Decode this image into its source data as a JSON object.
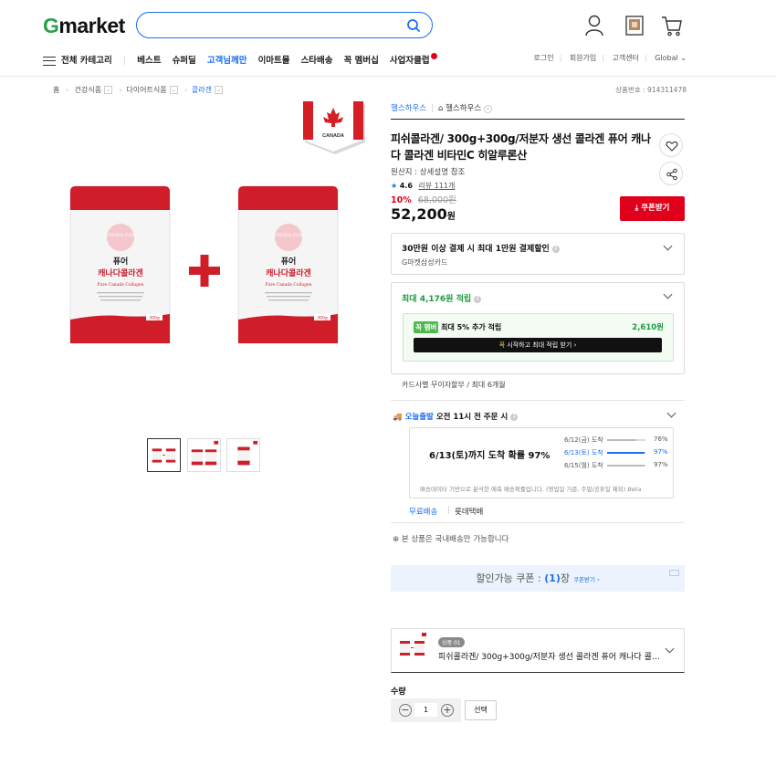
{
  "header": {
    "logo_g": "G",
    "logo_rest": "market",
    "search_placeholder": ""
  },
  "nav": {
    "all_categories": "전체 카테고리",
    "items": [
      "베스트",
      "슈퍼딜",
      "고객님께만",
      "이마트몰",
      "스타배송",
      "꼭 멤버십",
      "사업자클럽"
    ],
    "highlight_color": "#1d6ef5"
  },
  "util": [
    "로그인",
    "회원가입",
    "고객센터",
    "Global"
  ],
  "breadcrumb": [
    "홈",
    "건강식품",
    "다이어트식품",
    "콜라겐"
  ],
  "product_no": "상품번호 : 914311478",
  "store": {
    "name1": "헬스하우스",
    "name2": "헬스하우스"
  },
  "product": {
    "title": "피쉬콜라겐/ 300g+300g/저분자 생선 콜라겐 퓨어 캐나다 콜라겐 비타민C 히알루론산",
    "origin": "원산지 : 상세설명 참조",
    "rating": "4.6",
    "review_count": "리뷰 111개",
    "discount": "10%",
    "original_price": "68,000원",
    "price": "52,200",
    "price_unit": "원",
    "coupon_btn": "쿠폰받기"
  },
  "benefit": {
    "title": "30만원 이상 결제 시 최대 1만원 결제할인",
    "sub": "G마켓삼성카드"
  },
  "points": {
    "prefix": "최대 ",
    "amount": "4,176원",
    "suffix": " 적립",
    "member_tag": "꼭 멤버",
    "member_text": "최대 5% 추가 적립",
    "member_points": "2,610원",
    "member_btn_prefix": "꼭 ",
    "member_btn": "시작하고 최대 적립 받기"
  },
  "card_install": "카드사별 무이자할부 / 최대 6개월",
  "shipping": {
    "tag": "오늘출발",
    "text": "오전 11시 전 주문 시",
    "estimate": "6/13(토)까지 도착 확률 97%",
    "rows": [
      {
        "date": "6/12(금) 도착",
        "pct": "76%",
        "value": 76,
        "active": false
      },
      {
        "date": "6/13(토) 도착",
        "pct": "97%",
        "value": 97,
        "active": true
      },
      {
        "date": "6/15(월) 도착",
        "pct": "97%",
        "value": 97,
        "active": false
      }
    ],
    "footnote": "배송데이터 기반으로 분석한 예측 배송확률입니다. (영업일 기준, 주말/공휴일 제외)",
    "beta": "Beta",
    "free": "무료배송",
    "carrier": "롯데택배",
    "domestic": "본 상품은 국내배송만 가능합니다"
  },
  "coupon_bar": {
    "pre": "할인가능 쿠폰 : ",
    "count": "(1)",
    "post": "장",
    "link": "쿠폰받기"
  },
  "option": {
    "tag": "상품 01",
    "name": "피쉬콜라겐/ 300g+300g/저분자 생선 콜라겐 퓨어 캐나다 콜라겐 비타민C 히알루론산"
  },
  "quantity": {
    "label": "수량",
    "value": "1",
    "select_btn": "선택"
  },
  "packaging": {
    "flag_label": "CANADA",
    "brand": "CANADA FISH",
    "name_line1": "퓨어",
    "name_line2": "캐나다콜라겐",
    "name_en": "Pure Canada Collagen",
    "weight": "300g"
  }
}
